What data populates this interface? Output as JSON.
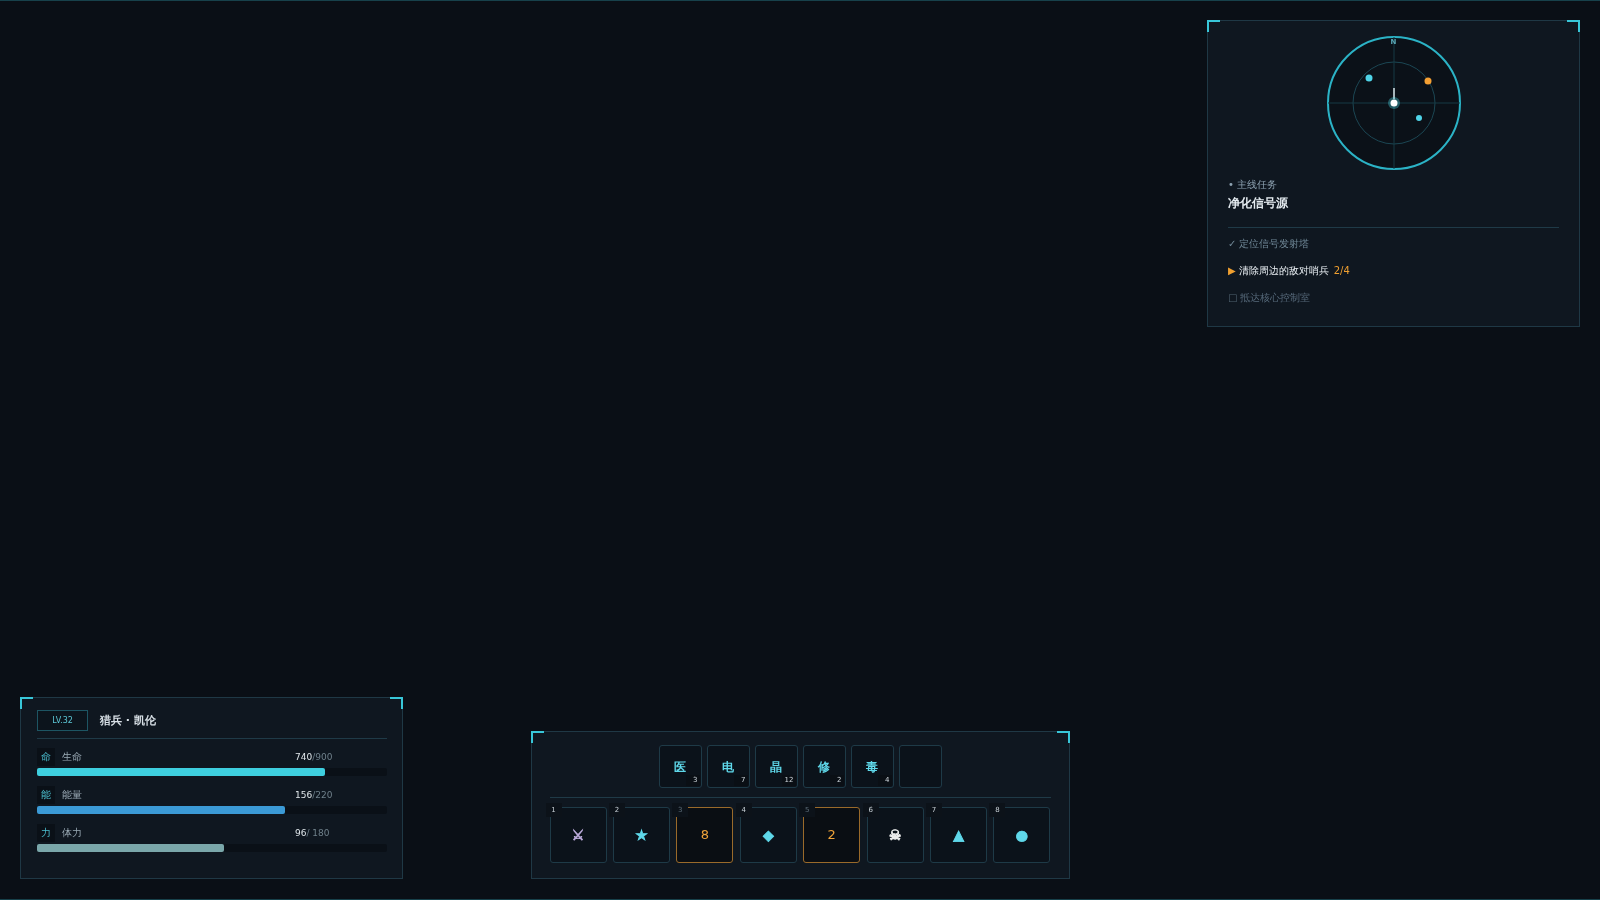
{
  "quest_panel": {
    "radar": {
      "north_label": "N",
      "blips": [
        {
          "color": "#4fd4e8"
        },
        {
          "color": "#f5a033"
        },
        {
          "color": "#4fd4e8"
        }
      ]
    },
    "category": "• 主线任务",
    "title": "净化信号源",
    "objectives": [
      {
        "kind": "done",
        "marker": "✓",
        "text": "定位信号发射塔"
      },
      {
        "kind": "active",
        "marker": "▶",
        "text": "清除周边的敌对哨兵",
        "progress": "2/4"
      },
      {
        "kind": "pending",
        "marker": "□",
        "text": "抵达核心控制室"
      }
    ]
  },
  "character_panel": {
    "level_badge": "LV.32",
    "name": "猎兵 · 凯伦",
    "stats": [
      {
        "glyph": "命",
        "label": "生命",
        "current": "740",
        "max": "/900",
        "level": 0.822,
        "color": "#3ecfdf"
      },
      {
        "glyph": "能",
        "label": "能量",
        "current": "156",
        "max": "/220",
        "level": 0.709,
        "color": "#3b9ad6"
      },
      {
        "glyph": "力",
        "label": "体力",
        "current": "96",
        "max": "/ 180",
        "level": 0.533,
        "color": "#7aa7aa"
      }
    ]
  },
  "hotbar": {
    "consumables": [
      {
        "kind": "item",
        "glyph": "医",
        "count": "3"
      },
      {
        "kind": "item",
        "glyph": "电",
        "count": "7"
      },
      {
        "kind": "item",
        "glyph": "晶",
        "count": "12"
      },
      {
        "kind": "item",
        "glyph": "修",
        "count": "2"
      },
      {
        "kind": "item",
        "glyph": "毒",
        "count": "4"
      },
      {
        "kind": "empty"
      }
    ],
    "skills": [
      {
        "kind": "ready",
        "key": "1",
        "icon": "⚔",
        "color": "#b9a8d8"
      },
      {
        "kind": "ready",
        "key": "2",
        "icon": "★",
        "color": "#5fd8ea"
      },
      {
        "kind": "cooldown",
        "key": "3",
        "cooldown": "8"
      },
      {
        "kind": "ready",
        "key": "4",
        "icon": "◆",
        "color": "#5fd8ea"
      },
      {
        "kind": "cooldown",
        "key": "5",
        "cooldown": "2"
      },
      {
        "kind": "ready",
        "key": "6",
        "icon": "☠",
        "color": "#ececec"
      },
      {
        "kind": "ready",
        "key": "7",
        "icon": "▲",
        "color": "#5fd8ea"
      },
      {
        "kind": "ready",
        "key": "8",
        "icon": "●",
        "color": "#5fd8ea"
      }
    ]
  }
}
